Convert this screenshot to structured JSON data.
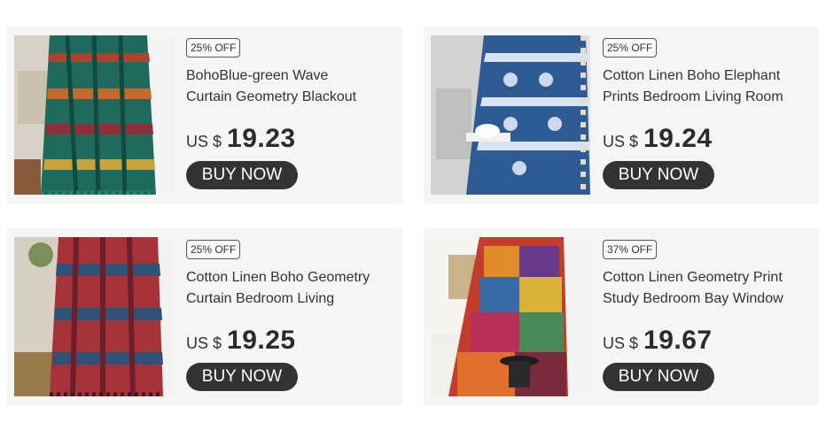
{
  "products": [
    {
      "discount": "25% OFF",
      "title": "BohoBlue-green Wave\nCurtain Geometry Blackout",
      "currency": "US $",
      "price": "19.23",
      "button": "BUY NOW",
      "image_icon": "curtain-image"
    },
    {
      "discount": "25% OFF",
      "title": "Cotton Linen Boho Elephant\nPrints Bedroom Living Room",
      "currency": "US $",
      "price": "19.24",
      "button": "BUY NOW",
      "image_icon": "curtain-image"
    },
    {
      "discount": "25% OFF",
      "title": "Cotton Linen Boho Geometry\nCurtain Bedroom Living",
      "currency": "US $",
      "price": "19.25",
      "button": "BUY NOW",
      "image_icon": "curtain-image"
    },
    {
      "discount": "37% OFF",
      "title": "Cotton Linen Geometry Print\nStudy Bedroom Bay Window",
      "currency": "US $",
      "price": "19.67",
      "button": "BUY NOW",
      "image_icon": "curtain-image"
    }
  ],
  "colors": {
    "card_bg": "#f5f5f5",
    "button_bg": "#333333",
    "button_text": "#ffffff"
  }
}
